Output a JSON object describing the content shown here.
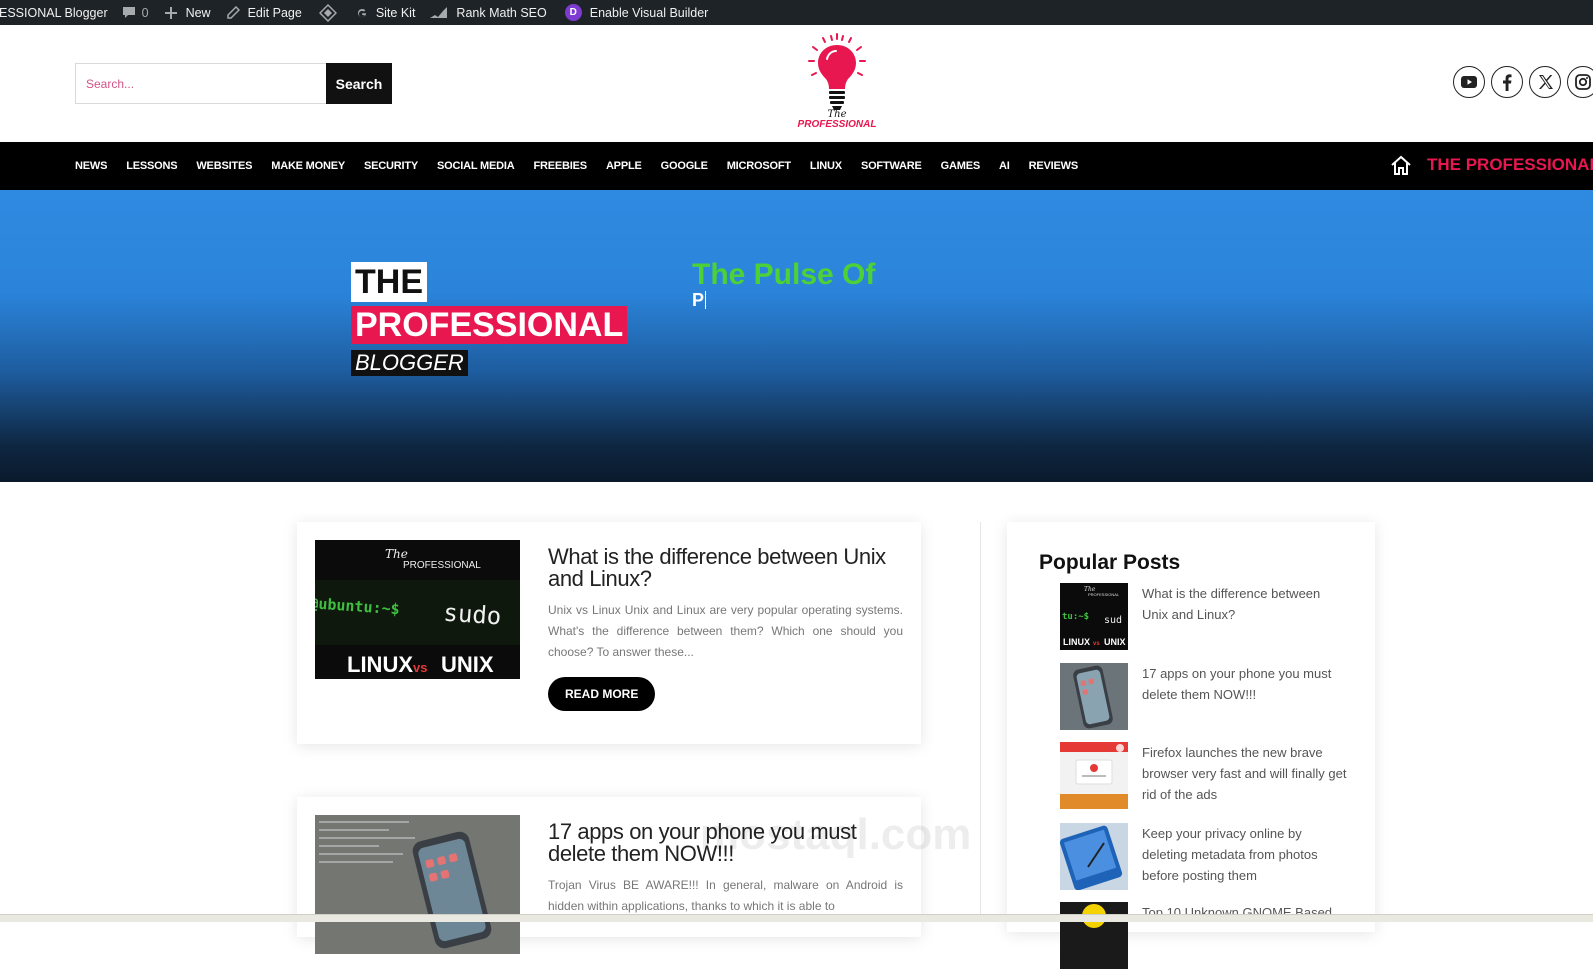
{
  "adminbar": {
    "site_name": "ESSIONAL Blogger",
    "comments_count": "0",
    "new_label": "New",
    "edit_page_label": "Edit Page",
    "site_kit_label": "Site Kit",
    "rank_math_label": "Rank Math SEO",
    "visual_builder_label": "Enable Visual Builder",
    "divi_badge": "D"
  },
  "header": {
    "search_placeholder": "Search...",
    "search_button": "Search",
    "logo_text": "PROFESSIONAL",
    "logo_script": "The",
    "socials": [
      "youtube-icon",
      "facebook-icon",
      "x-icon",
      "instagram-icon"
    ]
  },
  "nav": {
    "items": [
      "NEWS",
      "LESSONS",
      "WEBSITES",
      "MAKE MONEY",
      "SECURITY",
      "SOCIAL MEDIA",
      "FREEBIES",
      "APPLE",
      "GOOGLE",
      "MICROSOFT",
      "LINUX",
      "SOFTWARE",
      "GAMES",
      "AI",
      "REVIEWS"
    ],
    "brand": "THE PROFESSIONAL"
  },
  "hero": {
    "line1": "THE",
    "line2": "PROFESSIONAL",
    "line3": "BLOGGER",
    "tagline": "The Pulse Of",
    "typed": "P"
  },
  "posts": [
    {
      "title": "What is the difference between Unix and Linux?",
      "excerpt": "Unix vs Linux Unix and Linux are very popular operating systems. What's the difference between them? Which one should you choose? To answer these...",
      "read_more": "READ MORE",
      "thumb": {
        "script": "The",
        "brand": "PROFESSIONAL",
        "prompt": "@ubuntu:~$",
        "cmd": "sudo",
        "left": "LINUX",
        "vs": "vs",
        "right": "UNIX"
      }
    },
    {
      "title": "17 apps on your phone you must delete them NOW!!!",
      "excerpt": "Trojan Virus BE AWARE!!! In general, malware on Android is hidden within applications, thanks to which it is able to"
    }
  ],
  "sidebar": {
    "title": "Popular Posts",
    "items": [
      "What is the difference between Unix and Linux?",
      "17 apps on your phone you must delete them NOW!!!",
      "Firefox launches the new brave browser very fast and will finally get rid of the ads",
      "Keep your privacy online by deleting metadata from photos before posting them",
      "Top 10 Unknown GNOME Based"
    ],
    "thumb_labels": {
      "script": "The",
      "brand": "PROFESSIONAL",
      "prompt": "tu:~$",
      "cmd": "sud",
      "left": "LINUX",
      "vs": "vs",
      "right": "UNIX"
    }
  },
  "watermark": "mostaql.com",
  "colors": {
    "accent": "#e8174f",
    "green": "#4cd137",
    "hero_top": "#2e8ae0",
    "hero_bottom": "#0a1a2c"
  }
}
